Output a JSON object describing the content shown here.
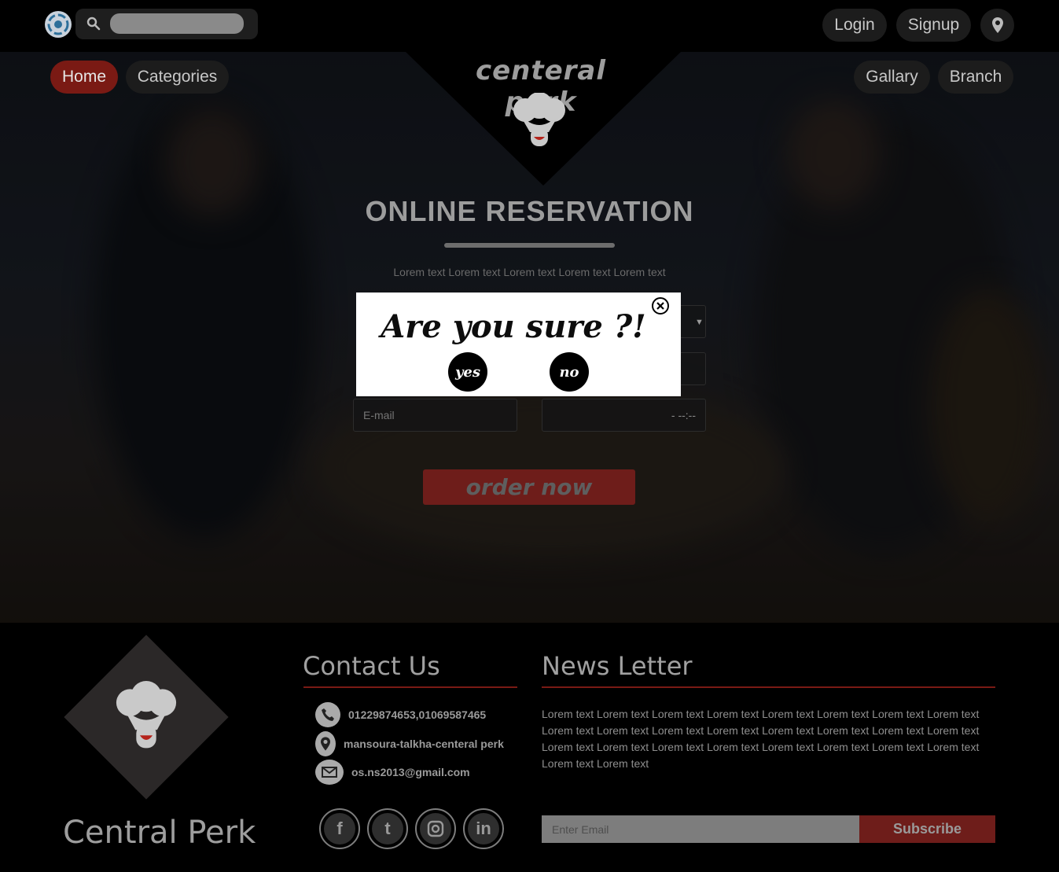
{
  "header": {
    "search": {
      "placeholder": ""
    },
    "auth": {
      "login_label": "Login",
      "signup_label": "Signup"
    },
    "icons": {
      "logo": "app-logo-icon",
      "search": "search-icon",
      "location": "location-pin-icon"
    }
  },
  "nav": {
    "left": [
      "Home",
      "Categories"
    ],
    "right": [
      "Gallary",
      "Branch"
    ],
    "active": "Home"
  },
  "brand": {
    "title": "centeral perk",
    "icon": "chef-hat-icon"
  },
  "reservation": {
    "title": "ONLINE RESERVATION",
    "description": "Lorem text Lorem text Lorem text Lorem text Lorem text",
    "email_placeholder": "E-mail",
    "time_placeholder": "- --:--",
    "order_label": "order now"
  },
  "modal": {
    "title": "Are you sure ?!",
    "yes_label": "yes",
    "no_label": "no",
    "close_icon": "close-circle-icon"
  },
  "footer": {
    "brand_name": "Central Perk",
    "contact": {
      "heading": "Contact Us",
      "phone": "01229874653,01069587465",
      "address": "mansoura-talkha-centeral perk",
      "email": "os.ns2013@gmail.com"
    },
    "social": [
      "facebook-icon",
      "twitter-icon",
      "instagram-icon",
      "linkedin-icon"
    ],
    "newsletter": {
      "heading": "News Letter",
      "text": "Lorem text Lorem text Lorem text Lorem text Lorem text Lorem text Lorem text Lorem text Lorem text Lorem text Lorem text Lorem text Lorem text Lorem text Lorem text Lorem text Lorem text Lorem text Lorem text Lorem text Lorem text Lorem text Lorem text Lorem text Lorem text Lorem text",
      "input_placeholder": "Enter Email",
      "subscribe_label": "Subscribe"
    }
  },
  "colors": {
    "accent": "#7a1a14",
    "modal_bg": "#ffffff",
    "footer_bg": "#000000"
  }
}
